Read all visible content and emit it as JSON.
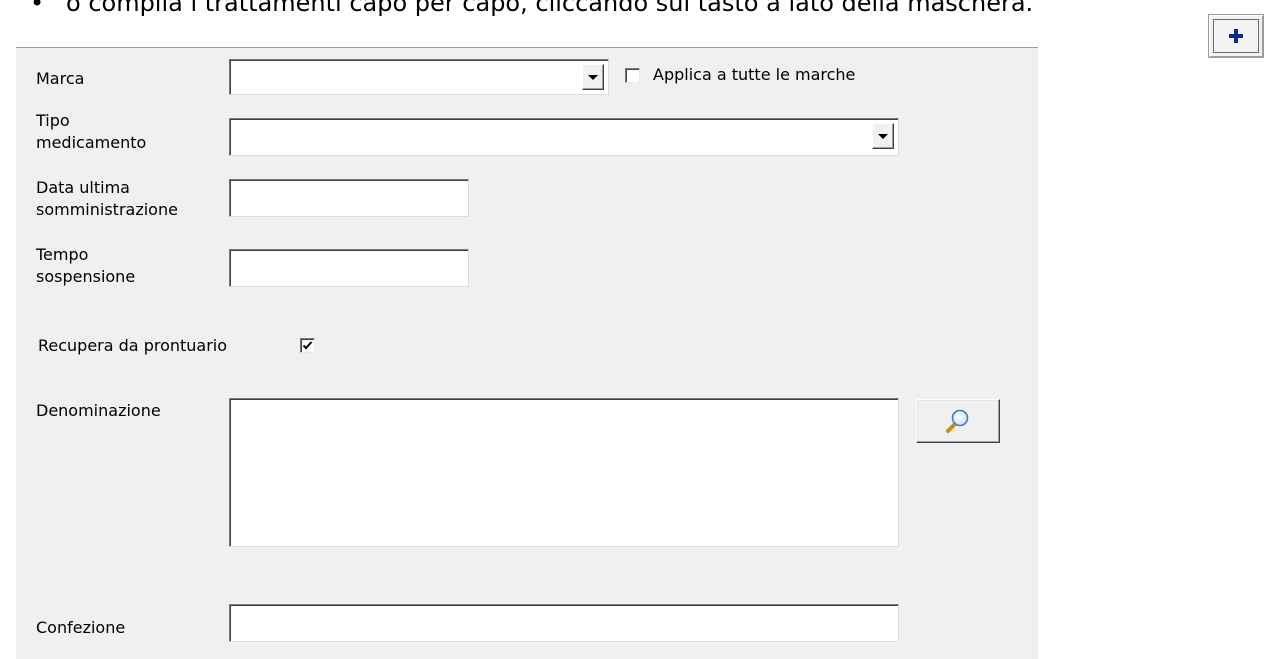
{
  "instruction": {
    "bullet": "•",
    "text": "o compila i trattamenti capo per capo, cliccando sul tasto a lato della maschera."
  },
  "form": {
    "marca": {
      "label": "Marca",
      "value": ""
    },
    "applica_tutte": {
      "label": "Applica a tutte le marche",
      "checked": false
    },
    "tipo_medicamento": {
      "label": "Tipo\nmedicamento",
      "value": ""
    },
    "data_ultima": {
      "label": "Data ultima\nsomministrazione",
      "value": ""
    },
    "tempo_sospensione": {
      "label": "Tempo\nsospensione",
      "value": ""
    },
    "recupera": {
      "label": "Recupera da prontuario",
      "checked": true
    },
    "denominazione": {
      "label": "Denominazione",
      "value": ""
    },
    "confezione": {
      "label": "Confezione",
      "value": ""
    }
  },
  "icons": {
    "add": "plus-icon",
    "search": "magnifier-icon",
    "dropdown": "chevron-down-icon",
    "check": "check-icon"
  },
  "colors": {
    "panel": "#f0f0f0",
    "plus": "#0b2b86"
  }
}
